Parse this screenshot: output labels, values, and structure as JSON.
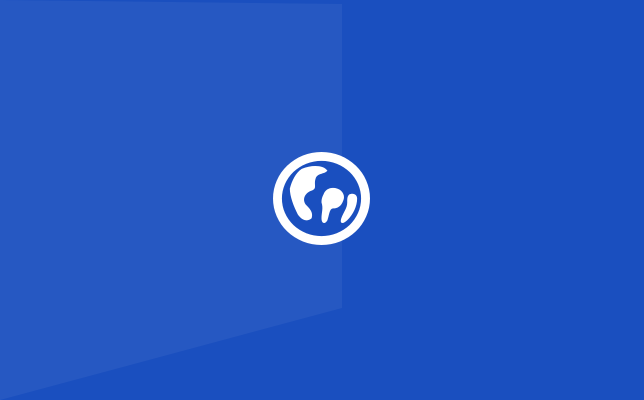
{
  "app_tile": {
    "icon": "globe-icon",
    "colors": {
      "background": "#1a4fbf",
      "panel_highlight": "#2a5fc8",
      "icon": "#ffffff"
    }
  }
}
